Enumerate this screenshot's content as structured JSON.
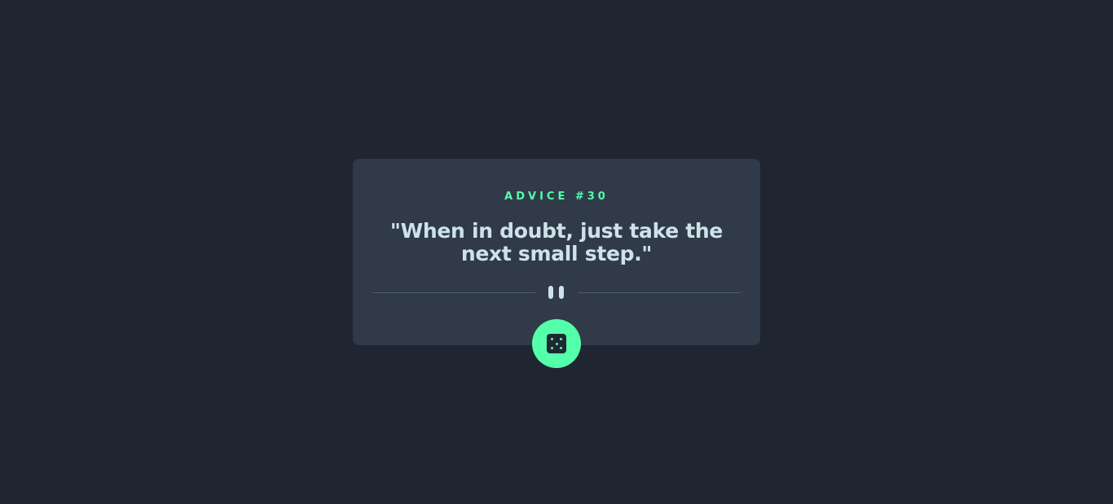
{
  "card": {
    "advice_label": "ADVICE #30",
    "quote": "\"When in doubt, just take the next small step.\""
  },
  "icons": {
    "divider": "pause-icon",
    "button": "dice-icon"
  },
  "colors": {
    "background": "#1f2632",
    "card": "#313a48",
    "accent": "#53ffaa",
    "text": "#cee3e9",
    "divider": "#4f5d74"
  }
}
